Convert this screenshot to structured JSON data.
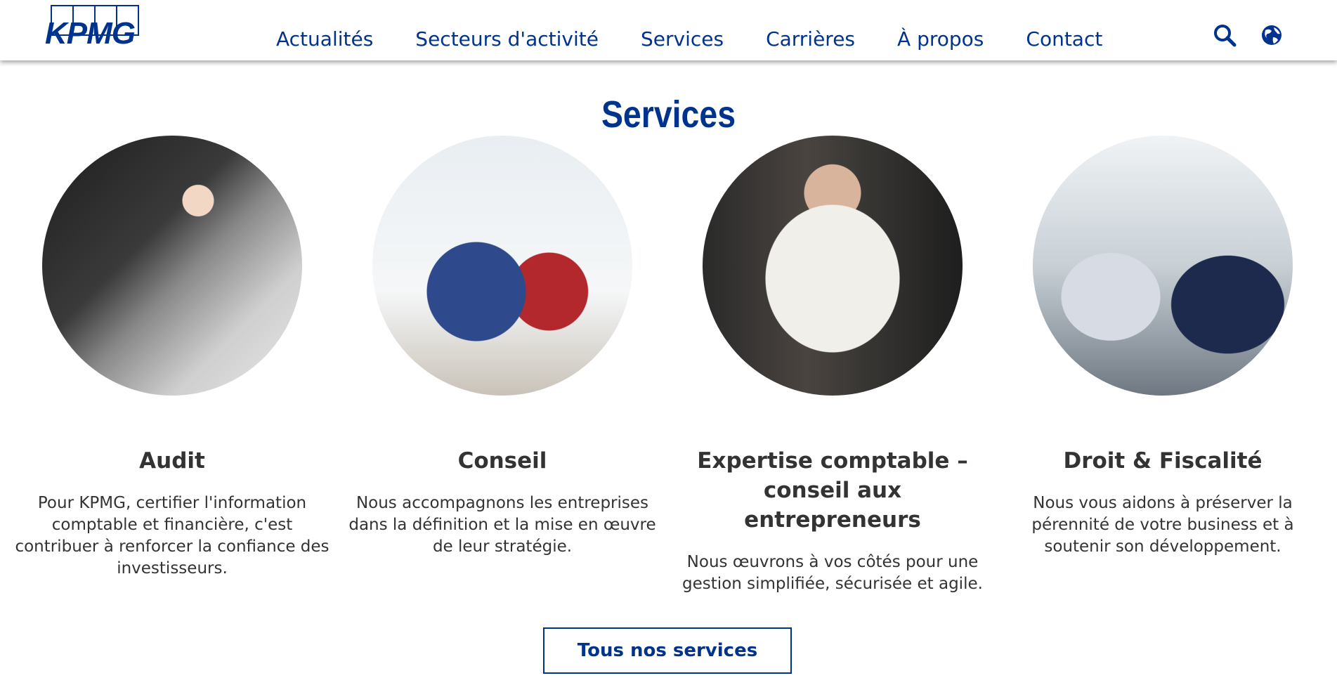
{
  "brand": {
    "logo_text": "KPMG",
    "color": "#00338d"
  },
  "nav": {
    "items": [
      "Actualités",
      "Secteurs d'activité",
      "Services",
      "Carrières",
      "À propos",
      "Contact"
    ]
  },
  "header_icons": {
    "search": "search-icon",
    "globe": "globe-icon"
  },
  "main": {
    "title": "Services",
    "cards": [
      {
        "title": "Audit",
        "description": "Pour KPMG, certifier l'information comptable et financière, c'est contribuer à renforcer la confiance des investisseurs."
      },
      {
        "title": "Conseil",
        "description": "Nous accompagnons les entreprises dans la définition et la mise en œuvre de leur stratégie."
      },
      {
        "title": "Expertise comptable – conseil aux entrepreneurs",
        "description": "Nous œuvrons à vos côtés pour une gestion simplifiée, sécurisée et agile."
      },
      {
        "title": "Droit & Fiscalité",
        "description": "Nous vous aidons à préserver la pérennité de votre business et à soutenir son développement."
      }
    ],
    "cta_label": "Tous nos services"
  }
}
